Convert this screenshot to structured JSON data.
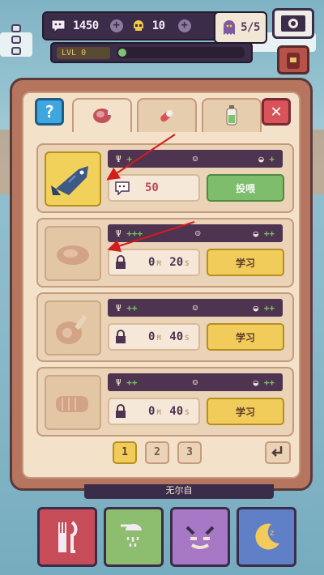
{
  "hud": {
    "coins": "1450",
    "skulls": "10",
    "health": "5/5",
    "level_label": "LVL 0",
    "xp_progress": 0.04
  },
  "tabs": [
    {
      "name": "food",
      "icon": "meat-icon",
      "active": true
    },
    {
      "name": "medicine",
      "icon": "pill-icon",
      "active": false
    },
    {
      "name": "potion",
      "icon": "bottle-icon",
      "active": false
    }
  ],
  "items": [
    {
      "food": "fish",
      "icon": "fish-icon",
      "stats": {
        "hunger": "+",
        "mood": "",
        "weight": "+"
      },
      "info": "50",
      "button": "投喂",
      "button_type": "feed"
    },
    {
      "food": "steak",
      "icon": "steak-icon",
      "stats": {
        "hunger": "+++",
        "mood": "",
        "weight": "++"
      },
      "info_min": "0",
      "info_sec": "20",
      "button": "学习",
      "button_type": "learn"
    },
    {
      "food": "ham",
      "icon": "ham-icon",
      "stats": {
        "hunger": "++",
        "mood": "",
        "weight": "++"
      },
      "info_min": "0",
      "info_sec": "40",
      "button": "学习",
      "button_type": "learn"
    },
    {
      "food": "roast",
      "icon": "roast-icon",
      "stats": {
        "hunger": "++",
        "mood": "",
        "weight": "++"
      },
      "info_min": "0",
      "info_sec": "40",
      "button": "学习",
      "button_type": "learn"
    }
  ],
  "units": {
    "minute": "M",
    "second": "S"
  },
  "pager": {
    "pages": [
      "1",
      "2",
      "3"
    ],
    "current": "1"
  },
  "name_strip": "无尔自",
  "nav": [
    {
      "name": "food",
      "icon": "fork-knife-icon"
    },
    {
      "name": "bath",
      "icon": "shower-icon"
    },
    {
      "name": "play",
      "icon": "devil-face-icon"
    },
    {
      "name": "sleep",
      "icon": "moon-icon"
    }
  ],
  "colors": {
    "panel": "#b5755e",
    "feed_button": "#7dbd6c",
    "learn_button": "#f2cc5a",
    "hud": "#3b2c4a"
  }
}
